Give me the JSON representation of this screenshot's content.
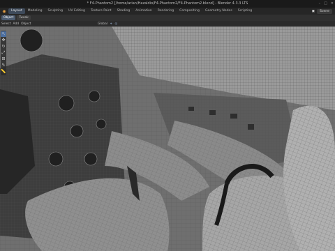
{
  "window": {
    "title": "* F4-Phantom2 [/home/arian/Hazaldio/F4-Phantom2/F4-Phantom2.blend] - Blender 4.3.3 LTS"
  },
  "menubar": {
    "workspaces": [
      "Layout",
      "Modeling",
      "Sculpting",
      "UV Editing",
      "Texture Paint",
      "Shading",
      "Animation",
      "Rendering",
      "Compositing",
      "Geometry Nodes",
      "Scripting"
    ],
    "active": "Layout",
    "scene_label": "Scene"
  },
  "header1": {
    "mode": "Object",
    "view": "Tweak"
  },
  "header2": {
    "select": "Select",
    "add": "Add",
    "object": "Object",
    "orientation": "Global"
  },
  "icons": [
    "blender-logo-icon",
    "minimize-icon",
    "maximize-icon",
    "close-icon",
    "scene-icon",
    "cursor-icon",
    "move-icon",
    "rotate-icon",
    "scale-icon",
    "transform-icon",
    "annotate-icon",
    "measure-icon"
  ]
}
